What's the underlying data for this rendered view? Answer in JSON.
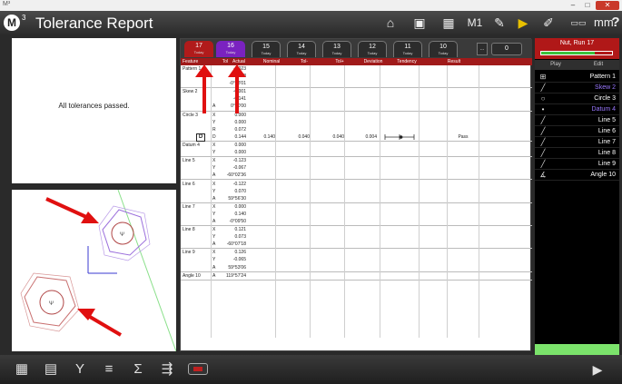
{
  "window": {
    "tag": "M³",
    "minimize": "–",
    "maximize": "□",
    "close": "✕"
  },
  "header": {
    "logo": "M",
    "logo_sup": "3",
    "title": "Tolerance Report",
    "m1_label": "M1",
    "units": "mm",
    "help": "?",
    "icons": [
      "home-icon",
      "camera-icon",
      "grid-icon",
      "probe-icon",
      "run-icon",
      "probe2-icon",
      "ruler-icon"
    ]
  },
  "message": {
    "text": "All tolerances passed."
  },
  "runs": {
    "tabs": [
      {
        "num": "17",
        "date": "Today",
        "state": "fail"
      },
      {
        "num": "16",
        "date": "Today",
        "state": "sel"
      },
      {
        "num": "15",
        "date": "Today",
        "state": "plain"
      },
      {
        "num": "14",
        "date": "Today",
        "state": "plain"
      },
      {
        "num": "13",
        "date": "Today",
        "state": "plain"
      },
      {
        "num": "12",
        "date": "Today",
        "state": "plain"
      },
      {
        "num": "11",
        "date": "Today",
        "state": "plain"
      },
      {
        "num": "10",
        "date": "Today",
        "state": "plain"
      }
    ],
    "more": "...",
    "count": "0"
  },
  "columns": {
    "feature": "Feature",
    "tol": "Tol",
    "actual": "Actual",
    "nominal": "Nominal",
    "tol_minus": "Tol-",
    "tol_plus": "Tol+",
    "deviation": "Deviation",
    "tendency": "Tendency",
    "result": "Result"
  },
  "rows": [
    {
      "feature": "Pattern 1",
      "lines": [
        {
          "axis": "",
          "actual": "-0.023"
        },
        {
          "axis": "",
          "actual": "0.008"
        },
        {
          "axis": "",
          "actual": "-0°48'01"
        }
      ]
    },
    {
      "feature": "Skew 2",
      "lines": [
        {
          "axis": "",
          "actual": "-0.001"
        },
        {
          "axis": "",
          "actual": "-0.141"
        },
        {
          "axis": "A",
          "actual": "0°00'00"
        }
      ]
    },
    {
      "feature": "Circle 3",
      "lines": [
        {
          "axis": "X",
          "actual": "0.000"
        },
        {
          "axis": "Y",
          "actual": "0.000"
        },
        {
          "axis": "R",
          "actual": "0.072"
        },
        {
          "axis": "D",
          "actual": "0.144",
          "nominal": "0.140",
          "tol_minus": "0.040",
          "tol_plus": "0.040",
          "deviation": "0.004",
          "result": "Pass",
          "tol_button": "D",
          "tendency": 0.55
        }
      ]
    },
    {
      "feature": "Datum 4",
      "lines": [
        {
          "axis": "X",
          "actual": "0.000"
        },
        {
          "axis": "Y",
          "actual": "0.000"
        }
      ]
    },
    {
      "feature": "Line 5",
      "lines": [
        {
          "axis": "X",
          "actual": "-0.123"
        },
        {
          "axis": "Y",
          "actual": "-0.067"
        },
        {
          "axis": "A",
          "actual": "-60°02'36"
        }
      ]
    },
    {
      "feature": "Line 6",
      "lines": [
        {
          "axis": "X",
          "actual": "-0.122"
        },
        {
          "axis": "Y",
          "actual": "0.070"
        },
        {
          "axis": "A",
          "actual": "59°56'30"
        }
      ]
    },
    {
      "feature": "Line 7",
      "lines": [
        {
          "axis": "X",
          "actual": "0.000"
        },
        {
          "axis": "Y",
          "actual": "0.140"
        },
        {
          "axis": "A",
          "actual": "-0°09'50"
        }
      ]
    },
    {
      "feature": "Line 8",
      "lines": [
        {
          "axis": "X",
          "actual": "0.121"
        },
        {
          "axis": "Y",
          "actual": "0.073"
        },
        {
          "axis": "A",
          "actual": "-60°07'18"
        }
      ]
    },
    {
      "feature": "Line 9",
      "lines": [
        {
          "axis": "X",
          "actual": "0.126"
        },
        {
          "axis": "Y",
          "actual": "-0.065"
        },
        {
          "axis": "A",
          "actual": "59°53'06"
        }
      ]
    },
    {
      "feature": "Angle 10",
      "lines": [
        {
          "axis": "A",
          "actual": "119°57'24"
        }
      ]
    }
  ],
  "run_panel": {
    "name": "Nut, Run 17",
    "progress": 0.75,
    "tabs": {
      "play": "Play",
      "edit": "Edit"
    },
    "features": [
      {
        "label": "Pattern 1",
        "icon": "pattern-icon",
        "glyph": "⊞",
        "color": "#ffffff",
        "bg": "#000000"
      },
      {
        "label": "Skew 2",
        "icon": "line-icon",
        "glyph": "╱",
        "color": "#9a78ff",
        "bg": "#000000"
      },
      {
        "label": "Circle 3",
        "icon": "circle-icon",
        "glyph": "○",
        "color": "#ffffff",
        "bg": "#000000"
      },
      {
        "label": "Datum 4",
        "icon": "point-icon",
        "glyph": "•",
        "color": "#9a78ff",
        "bg": "#000000"
      },
      {
        "label": "Line 5",
        "icon": "line-icon",
        "glyph": "╱",
        "color": "#ffffff",
        "bg": "#000000"
      },
      {
        "label": "Line 6",
        "icon": "line-icon",
        "glyph": "╱",
        "color": "#ffffff",
        "bg": "#000000"
      },
      {
        "label": "Line 7",
        "icon": "line-icon",
        "glyph": "╱",
        "color": "#ffffff",
        "bg": "#000000"
      },
      {
        "label": "Line 8",
        "icon": "line-icon",
        "glyph": "╱",
        "color": "#ffffff",
        "bg": "#000000"
      },
      {
        "label": "Line 9",
        "icon": "line-icon",
        "glyph": "╱",
        "color": "#ffffff",
        "bg": "#000000"
      },
      {
        "label": "Angle 10",
        "icon": "angle-icon",
        "glyph": "∡",
        "color": "#ffffff",
        "bg": "#000000"
      }
    ]
  },
  "toolbar": {
    "icons": [
      "grid-view-icon",
      "table-view-icon",
      "filter-icon",
      "list-icon",
      "sigma-icon",
      "export-icon",
      "record-icon",
      "play-icon"
    ]
  },
  "colors": {
    "fail_tab": "#b11b1b",
    "selected_tab": "#7a22c0",
    "header_red": "#a01a1a",
    "accent_green": "#7be36b",
    "annotation_red": "#e01010"
  }
}
